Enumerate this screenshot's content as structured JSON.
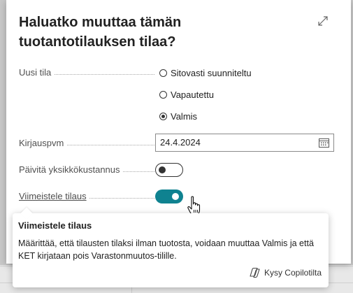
{
  "dialog": {
    "title": "Haluatko muuttaa tämän tuotantotilauksen tilaa?"
  },
  "fields": {
    "new_status": {
      "label": "Uusi tila",
      "options": [
        {
          "label": "Sitovasti suunniteltu",
          "selected": false
        },
        {
          "label": "Vapautettu",
          "selected": false
        },
        {
          "label": "Valmis",
          "selected": true
        }
      ]
    },
    "posting_date": {
      "label": "Kirjauspvm",
      "value": "24.4.2024"
    },
    "update_unit_cost": {
      "label": "Päivitä yksikkökustannus",
      "on": false
    },
    "finish_order": {
      "label": "Viimeistele tilaus",
      "on": true
    }
  },
  "tooltip": {
    "title": "Viimeistele tilaus",
    "body": "Määrittää, että tilausten tilaksi ilman tuotosta, voidaan muuttaa Valmis ja että KET kirjataan pois Varastonmuutos-tilille.",
    "copilot_label": "Kysy Copilotilta"
  },
  "colors": {
    "toggle_on": "#0f8290",
    "toggle_off_border": "#333333",
    "link_text": "#4d4d4d"
  },
  "icons": {
    "expand": "expand-icon",
    "calendar": "calendar-icon",
    "copilot": "copilot-icon",
    "cursor": "hand-pointer-icon"
  }
}
